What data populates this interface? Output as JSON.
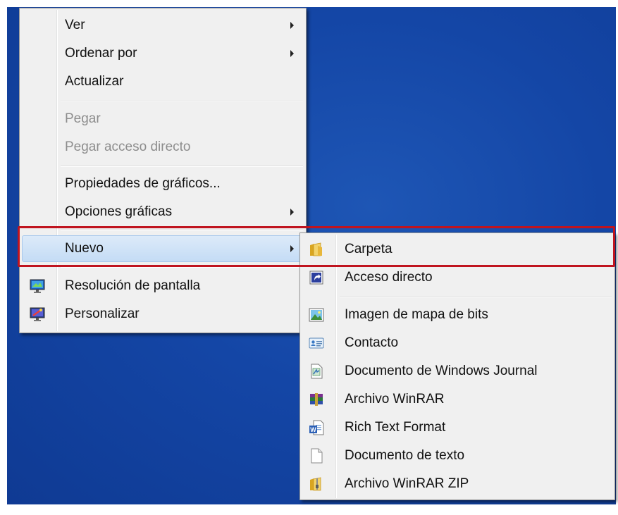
{
  "context_menu": {
    "items": [
      {
        "label": "Ver",
        "has_submenu": true,
        "enabled": true
      },
      {
        "label": "Ordenar por",
        "has_submenu": true,
        "enabled": true
      },
      {
        "label": "Actualizar",
        "has_submenu": false,
        "enabled": true
      },
      {
        "label": "Pegar",
        "has_submenu": false,
        "enabled": false
      },
      {
        "label": "Pegar acceso directo",
        "has_submenu": false,
        "enabled": false
      },
      {
        "label": "Propiedades de gráficos...",
        "has_submenu": false,
        "enabled": true
      },
      {
        "label": "Opciones gráficas",
        "has_submenu": true,
        "enabled": true
      },
      {
        "label": "Nuevo",
        "has_submenu": true,
        "enabled": true,
        "highlighted": true
      },
      {
        "label": "Resolución de pantalla",
        "icon": "display-settings-icon",
        "enabled": true
      },
      {
        "label": "Personalizar",
        "icon": "personalize-icon",
        "enabled": true
      }
    ]
  },
  "new_submenu": {
    "items": [
      {
        "label": "Carpeta",
        "icon": "folder-icon"
      },
      {
        "label": "Acceso directo",
        "icon": "shortcut-icon"
      },
      {
        "label": "Imagen de mapa de bits",
        "icon": "bitmap-image-icon"
      },
      {
        "label": "Contacto",
        "icon": "contact-icon"
      },
      {
        "label": "Documento de Windows Journal",
        "icon": "journal-icon"
      },
      {
        "label": "Archivo WinRAR",
        "icon": "winrar-icon"
      },
      {
        "label": "Rich Text Format",
        "icon": "word-document-icon"
      },
      {
        "label": "Documento de texto",
        "icon": "text-document-icon"
      },
      {
        "label": "Archivo WinRAR ZIP",
        "icon": "zip-archive-icon"
      }
    ]
  },
  "colors": {
    "desktop": "#1446a6",
    "menu_background": "#f0f0f0",
    "highlight": "#cfe3f7",
    "callout": "#c0141f"
  }
}
